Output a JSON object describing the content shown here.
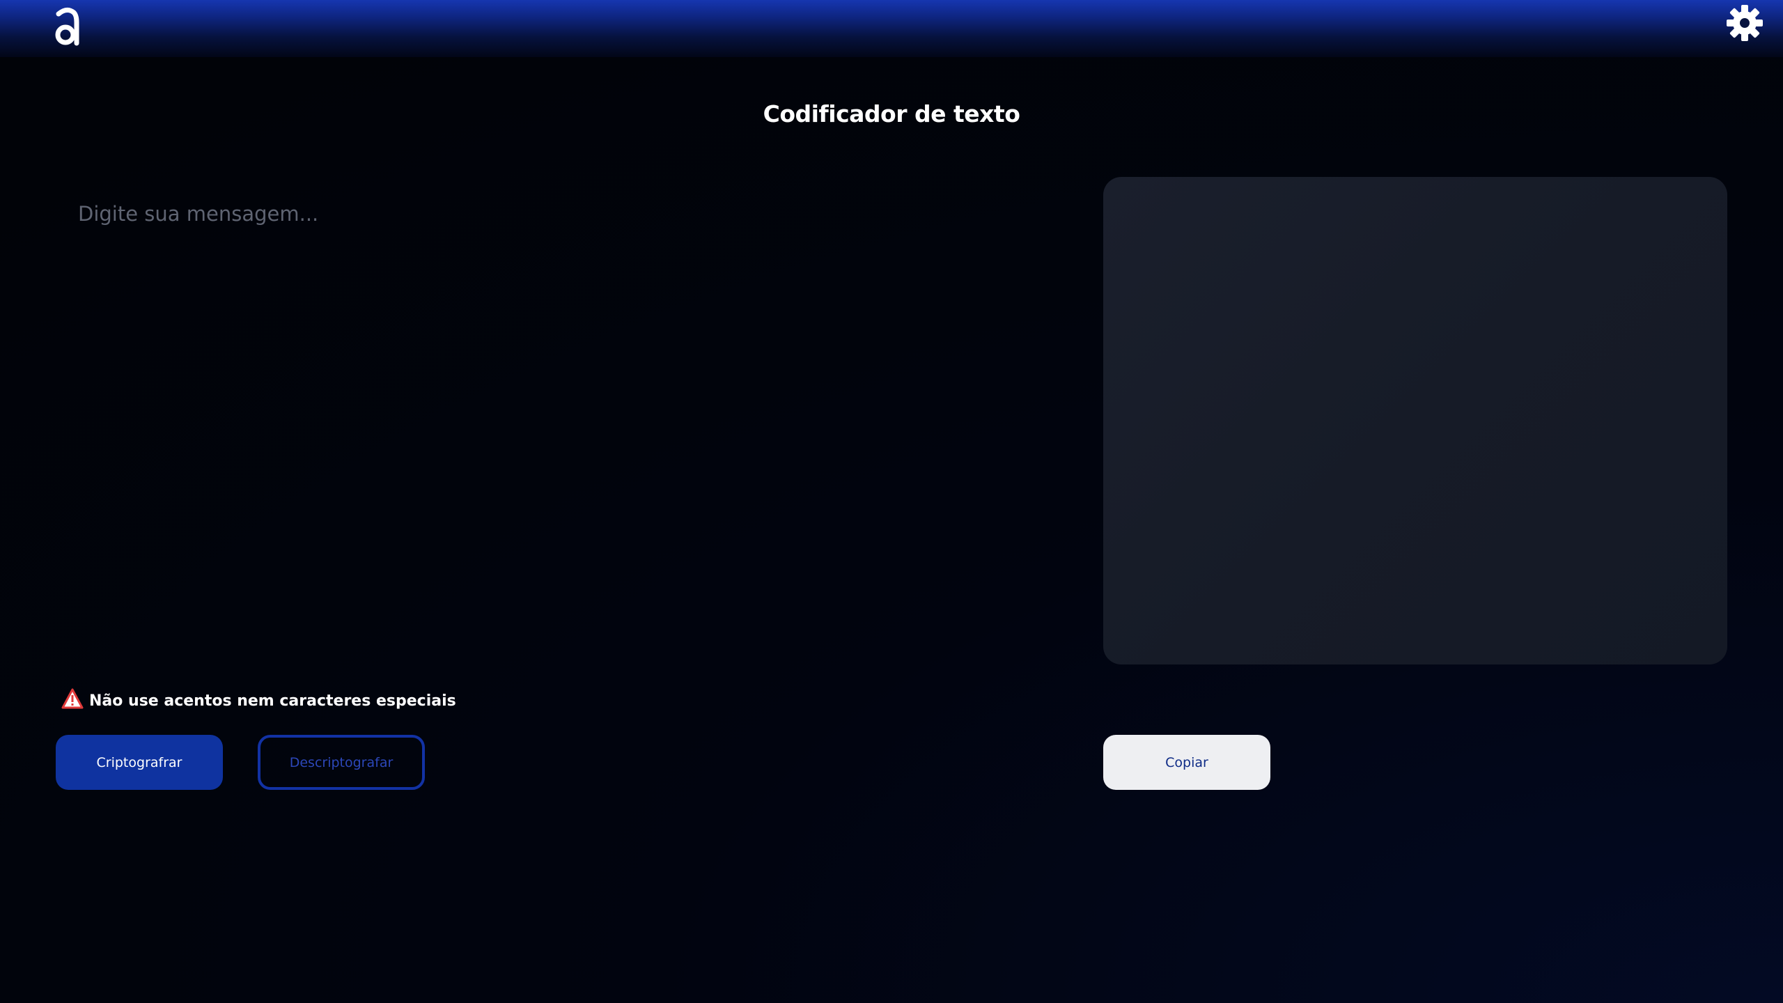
{
  "header": {
    "logo_icon": "alura-a-logo-icon",
    "settings_icon": "gear-icon"
  },
  "main": {
    "title": "Codificador de texto",
    "input": {
      "placeholder": "Digite sua mensagem...",
      "value": ""
    },
    "output": {
      "text": ""
    },
    "warning": {
      "icon": "warning-triangle-icon",
      "text": "Não use acentos nem caracteres especiais"
    },
    "buttons": {
      "encrypt_label": "Criptografrar",
      "decrypt_label": "Descriptografar",
      "copy_label": "Copiar"
    }
  },
  "colors": {
    "primary": "#0f33a0",
    "header_top": "#1636b0",
    "background": "#010308",
    "panel": "#171c28",
    "copy_button_bg": "#eeeff2",
    "warning_red": "#e03a3a"
  }
}
